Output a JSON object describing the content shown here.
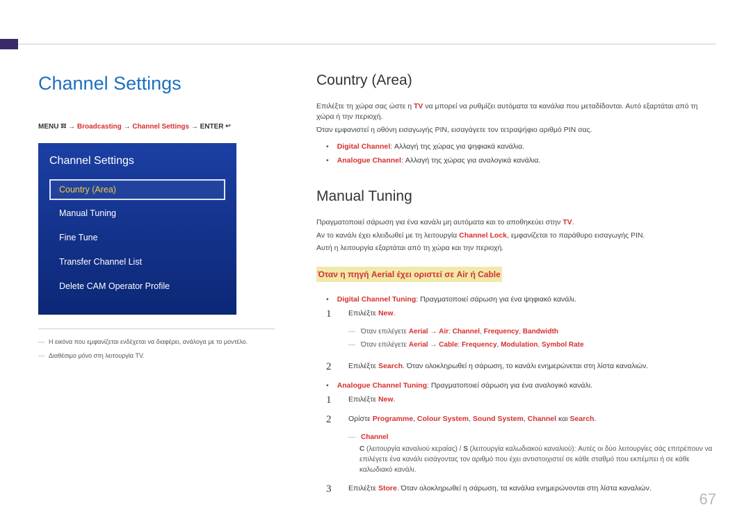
{
  "page_number": "67",
  "main_title": "Channel Settings",
  "menu_path": {
    "pre": "MENU",
    "menu_icon": "𝍌",
    "arrow": "→",
    "p1": "Broadcasting",
    "p2": "Channel Settings",
    "p3": "ENTER",
    "enter_icon": "↩"
  },
  "tv_panel": {
    "title": "Channel Settings",
    "items": [
      "Country (Area)",
      "Manual Tuning",
      "Fine Tune",
      "Transfer Channel List",
      "Delete CAM Operator Profile"
    ]
  },
  "left_notes": {
    "n1": "Η εικόνα που εμφανίζεται ενδέχεται να διαφέρει, ανάλογα με το μοντέλο.",
    "n2": "Διαθέσιμο μόνο στη λειτουργία TV."
  },
  "country": {
    "title": "Country (Area)",
    "p1a": "Επιλέξτε τη χώρα σας ώστε η ",
    "p1b": "TV",
    "p1c": " να μπορεί να ρυθμίζει αυτόματα τα κανάλια που μεταδίδονται. Αυτό εξαρτάται από τη χώρα ή την περιοχή.",
    "p2": "Όταν εμφανιστεί η οθόνη εισαγωγής PIN, εισαγάγετε τον τετραψήφιο αριθμό PIN σας.",
    "b1_hl": "Digital Channel",
    "b1": ": Αλλαγή της χώρας για ψηφιακά κανάλια.",
    "b2_hl": "Analogue Channel",
    "b2": ": Αλλαγή της χώρας για αναλογικά κανάλια."
  },
  "manual": {
    "title": "Manual Tuning",
    "p1a": "Πραγματοποιεί σάρωση για ένα κανάλι μη αυτόματα και το αποθηκεύει στην ",
    "p1b": "TV",
    "p1c": ".",
    "p2a": "Αν το κανάλι έχει κλειδωθεί με τη λειτουργία ",
    "p2b": "Channel Lock",
    "p2c": ", εμφανίζεται το παράθυρο εισαγωγής PIN.",
    "p3": "Αυτή η λειτουργία εξαρτάται από τη χώρα και την περιοχή.",
    "subheading": "Όταν η πηγή Aerial έχει οριστεί σε Air ή Cable",
    "bullet_dct_hl": "Digital Channel Tuning",
    "bullet_dct": ": Πραγματοποιεί σάρωση για ένα ψηφιακό κανάλι.",
    "s1a": "Επιλέξτε ",
    "s1b": "New",
    "s1c": ".",
    "s1_sub1_pre": "Όταν επιλέγετε ",
    "s1_sub1_h1": "Aerial",
    "s1_sub1_arrow": " → ",
    "s1_sub1_h2": "Air",
    "s1_sub1_colon": ": ",
    "s1_sub1_h3": "Channel",
    "s1_sub1_sep": ", ",
    "s1_sub1_h4": "Frequency",
    "s1_sub1_h5": "Bandwidth",
    "s1_sub2_pre": "Όταν επιλέγετε ",
    "s1_sub2_h1": "Aerial",
    "s1_sub2_h2": "Cable",
    "s1_sub2_h3": "Frequency",
    "s1_sub2_h4": "Modulation",
    "s1_sub2_h5": "Symbol Rate",
    "s2a": "Επιλέξτε ",
    "s2b": "Search",
    "s2c": ". Όταν ολοκληρωθεί η σάρωση, το κανάλι ενημερώνεται στη λίστα καναλιών.",
    "bullet_act_hl": "Analogue Channel Tuning",
    "bullet_act": ": Πραγματοποιεί σάρωση για ένα αναλογικό κανάλι.",
    "a1a": "Επιλέξτε ",
    "a1b": "New",
    "a1c": ".",
    "a2a": "Ορίστε ",
    "a2b": "Programme",
    "a2sep": ", ",
    "a2c": "Colour System",
    "a2d": "Sound System",
    "a2e": "Channel",
    "a2f": " και ",
    "a2g": "Search",
    "a2h": ".",
    "ch_title": "Channel",
    "ch_body_a": "C",
    "ch_body_b": " (λειτουργία καναλιού κεραίας) / ",
    "ch_body_c": "S",
    "ch_body_d": " (λειτουργία καλωδιακού καναλιού): Αυτές οι δύο λειτουργίες σάς επιτρέπουν να επιλέγετε ένα κανάλι εισάγοντας τον αριθμό που έχει αντιστοιχιστεί σε κάθε σταθμό που εκπέμπει ή σε κάθε καλωδιακό κανάλι.",
    "a3a": "Επιλέξτε ",
    "a3b": "Store",
    "a3c": ". Όταν ολοκληρωθεί η σάρωση, τα κανάλια ενημερώνονται στη λίστα καναλιών."
  }
}
